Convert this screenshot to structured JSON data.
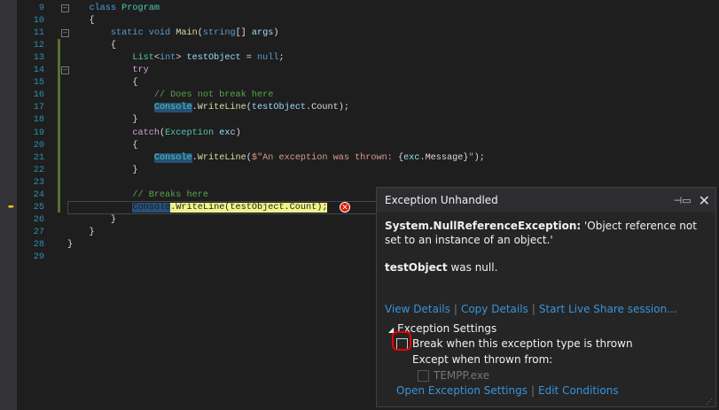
{
  "editor": {
    "lines": [
      {
        "n": "9",
        "t": [
          [
            "kw",
            "    class "
          ],
          [
            "ty",
            "Program"
          ]
        ]
      },
      {
        "n": "10",
        "t": [
          [
            "pl",
            "    {"
          ]
        ]
      },
      {
        "n": "11",
        "t": [
          [
            "kw",
            "        static void "
          ],
          [
            "me",
            "Main"
          ],
          [
            "pl",
            "("
          ],
          [
            "kw",
            "string"
          ],
          [
            "pl",
            "[] "
          ],
          [
            "va",
            "args"
          ],
          [
            "pl",
            ")"
          ]
        ]
      },
      {
        "n": "12",
        "t": [
          [
            "pl",
            "        {"
          ]
        ]
      },
      {
        "n": "13",
        "t": [
          [
            "pl",
            "            "
          ],
          [
            "ty",
            "List"
          ],
          [
            "pl",
            "<"
          ],
          [
            "kw",
            "int"
          ],
          [
            "pl",
            "> "
          ],
          [
            "va",
            "testObject"
          ],
          [
            "pl",
            " = "
          ],
          [
            "kw",
            "null"
          ],
          [
            "pl",
            ";"
          ]
        ]
      },
      {
        "n": "14",
        "t": [
          [
            "ct",
            "            try"
          ]
        ]
      },
      {
        "n": "15",
        "t": [
          [
            "pl",
            "            {"
          ]
        ]
      },
      {
        "n": "16",
        "t": [
          [
            "cm",
            "                // Does not break here"
          ]
        ]
      },
      {
        "n": "17",
        "t": [
          [
            "pl",
            "                "
          ],
          [
            "ty hl",
            "Console"
          ],
          [
            "pl",
            "."
          ],
          [
            "me",
            "WriteLine"
          ],
          [
            "pl",
            "("
          ],
          [
            "va",
            "testObject"
          ],
          [
            "pl",
            "."
          ],
          [
            "pl",
            "Count);"
          ]
        ]
      },
      {
        "n": "18",
        "t": [
          [
            "pl",
            "            }"
          ]
        ]
      },
      {
        "n": "19",
        "t": [
          [
            "ct",
            "            catch"
          ],
          [
            "pl",
            "("
          ],
          [
            "ty",
            "Exception"
          ],
          [
            "pl",
            " "
          ],
          [
            "va",
            "exc"
          ],
          [
            "pl",
            ")"
          ]
        ]
      },
      {
        "n": "20",
        "t": [
          [
            "pl",
            "            {"
          ]
        ]
      },
      {
        "n": "21",
        "t": [
          [
            "pl",
            "                "
          ],
          [
            "ty hl",
            "Console"
          ],
          [
            "pl",
            "."
          ],
          [
            "me",
            "WriteLine"
          ],
          [
            "pl",
            "("
          ],
          [
            "st",
            "$\"An exception was thrown: "
          ],
          [
            "pl",
            "{"
          ],
          [
            "va",
            "exc"
          ],
          [
            "pl",
            ".Message}"
          ],
          [
            "st",
            "\""
          ],
          [
            "pl",
            ");"
          ]
        ]
      },
      {
        "n": "22",
        "t": [
          [
            "pl",
            "            }"
          ]
        ]
      },
      {
        "n": "23",
        "t": [
          [
            "pl",
            ""
          ]
        ]
      },
      {
        "n": "24",
        "t": [
          [
            "cm",
            "            // Breaks here"
          ]
        ]
      },
      {
        "n": "25",
        "t": [
          [
            "pl",
            "            "
          ],
          [
            "curhl",
            "Console"
          ],
          [
            "cur",
            ".WriteLine(testObject.Count);"
          ]
        ]
      },
      {
        "n": "26",
        "t": [
          [
            "pl",
            "        }"
          ]
        ]
      },
      {
        "n": "27",
        "t": [
          [
            "pl",
            "    }"
          ]
        ]
      },
      {
        "n": "28",
        "t": [
          [
            "pl",
            "}"
          ]
        ]
      },
      {
        "n": "29",
        "t": [
          [
            "pl",
            ""
          ]
        ]
      }
    ]
  },
  "exception": {
    "title": "Exception Unhandled",
    "type": "System.NullReferenceException:",
    "message": " 'Object reference not set to an instance of an object.'",
    "var": "testObject",
    "note": " was null.",
    "links": [
      "View Details",
      "Copy Details",
      "Start Live Share session..."
    ],
    "settings_label": "Exception Settings",
    "break_label": "Break when this exception type is thrown",
    "break_checked": false,
    "except_label": "Except when thrown from:",
    "module": "TEMPP.exe",
    "bottom_links": [
      "Open Exception Settings",
      "Edit Conditions"
    ]
  }
}
